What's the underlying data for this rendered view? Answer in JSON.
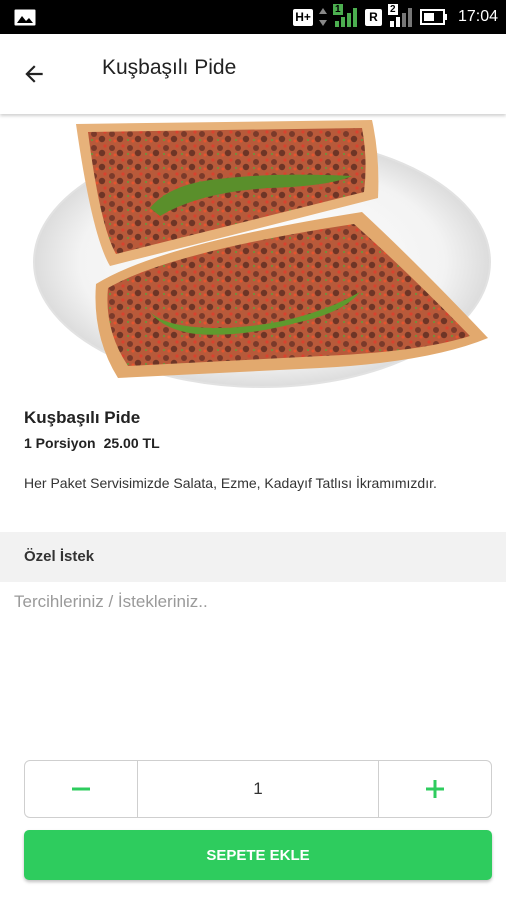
{
  "status_bar": {
    "network_label": "H+",
    "sim1_label": "1",
    "r_label": "R",
    "sim2_label": "2",
    "time": "17:04"
  },
  "app_bar": {
    "title": "Kuşbaşılı Pide",
    "back_icon": "arrow-left-icon"
  },
  "product": {
    "image_alt": "pide-photo",
    "name": "Kuşbaşılı Pide",
    "portion": "1 Porsiyon",
    "price": "25.00 TL",
    "note": "Her Paket Servisimizde Salata, Ezme, Kadayıf Tatlısı İkramımızdır."
  },
  "special_request": {
    "header": "Özel İstek",
    "placeholder": "Tercihleriniz / İstekleriniz.."
  },
  "quantity": {
    "decrement_icon": "minus-icon",
    "value": "1",
    "increment_icon": "plus-icon"
  },
  "add_to_cart": {
    "label": "SEPETE EKLE"
  },
  "colors": {
    "accent_green": "#2ecc5e",
    "status_bar_bg": "#000000",
    "section_bg": "#f2f2f2"
  }
}
